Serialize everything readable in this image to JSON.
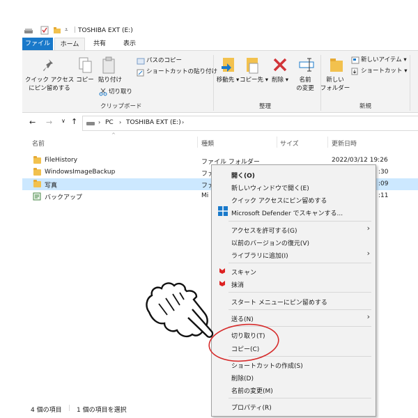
{
  "window": {
    "title": "TOSHIBA EXT (E:)"
  },
  "tabs": [
    "ファイル",
    "ホーム",
    "共有",
    "表示"
  ],
  "ribbon": {
    "pin_quick_access": [
      "クイック アクセス",
      "にピン留めする"
    ],
    "copy": "コピー",
    "paste": "貼り付け",
    "copy_path": "パスのコピー",
    "paste_shortcut": "ショートカットの貼り付け",
    "cut": "切り取り",
    "move_to": "移動先",
    "copy_to": "コピー先",
    "delete": "削除",
    "rename": [
      "名前",
      "の変更"
    ],
    "new_folder": [
      "新しい",
      "フォルダー"
    ],
    "new_item": "新しいアイテム",
    "easy_access": "ショートカット",
    "groups": {
      "clipboard": "クリップボード",
      "organize": "整理",
      "new": "新規"
    }
  },
  "address": {
    "crumbs": [
      "PC",
      "TOSHIBA EXT (E:)"
    ]
  },
  "columns": {
    "name": "名前",
    "type": "種類",
    "size": "サイズ",
    "date": "更新日時"
  },
  "files": [
    {
      "name": "FileHistory",
      "type": "ファイル フォルダー",
      "date": "2022/03/12 19:26"
    },
    {
      "name": "WindowsImageBackup",
      "type": "ファ",
      "date": ":30"
    },
    {
      "name": "写真",
      "type": "ファ",
      "date": ":09"
    },
    {
      "name": "バックアップ",
      "type": "Mi",
      "date": ":11"
    }
  ],
  "context_menu": {
    "open": "開く(O)",
    "open_new_window": "新しいウィンドウで開く(E)",
    "pin_quick": "クイック アクセスにピン留めする",
    "defender": "Microsoft Defender でスキャンする...",
    "give_access": "アクセスを許可する(G)",
    "restore_prev": "以前のバージョンの復元(V)",
    "add_library": "ライブラリに追加(I)",
    "scan": "スキャン",
    "wipe": "抹消",
    "pin_start": "スタート メニューにピン留めする",
    "send_to": "送る(N)",
    "cut": "切り取り(T)",
    "copy": "コピー(C)",
    "create_shortcut": "ショートカットの作成(S)",
    "delete": "削除(D)",
    "rename": "名前の変更(M)",
    "properties": "プロパティ(R)"
  },
  "status": {
    "count": "4 個の項目",
    "selected": "1 個の項目を選択"
  },
  "colors": {
    "file_tab": "#1979ca",
    "selection": "#cce8ff",
    "annotation": "#d62b2b",
    "delete_x": "#d13438"
  }
}
